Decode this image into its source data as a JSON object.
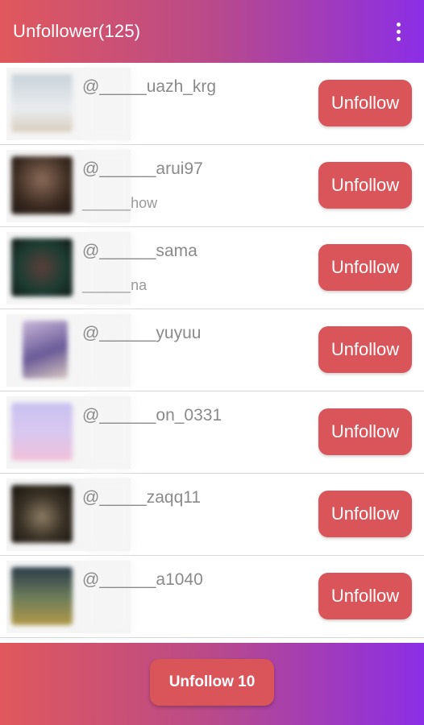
{
  "appbar": {
    "title": "Unfollower(125)",
    "menu_icon": "more-vert-icon"
  },
  "users": [
    {
      "username": "@_____uazh_krg",
      "display": "",
      "button": "Unfollow",
      "avatar_colors": [
        "#c9d3da",
        "#e9ecef"
      ]
    },
    {
      "username": "@______arui97",
      "display": "______how",
      "button": "Unfollow",
      "avatar_colors": [
        "#6b4a3a",
        "#2b1f1a"
      ]
    },
    {
      "username": "@______sama",
      "display": "______na",
      "button": "Unfollow",
      "avatar_colors": [
        "#2f5d4a",
        "#12221c"
      ]
    },
    {
      "username": "@______yuyuu",
      "display": "",
      "button": "Unfollow",
      "avatar_colors": [
        "#7a6aa8",
        "#c9b8d9"
      ]
    },
    {
      "username": "@______on_0331",
      "display": "",
      "button": "Unfollow",
      "avatar_colors": [
        "#c8b9f0",
        "#f0c0d8"
      ]
    },
    {
      "username": "@_____zaqq11",
      "display": "",
      "button": "Unfollow",
      "avatar_colors": [
        "#3a3226",
        "#15120d"
      ]
    },
    {
      "username": "@______a1040",
      "display": "",
      "button": "Unfollow",
      "avatar_colors": [
        "#4a6a7a",
        "#8a7a3a"
      ]
    }
  ],
  "bottom": {
    "button": "Unfollow 10"
  },
  "colors": {
    "accent": "#d9555a",
    "gradient_start": "#e0585c",
    "gradient_end": "#8b2ee6"
  }
}
